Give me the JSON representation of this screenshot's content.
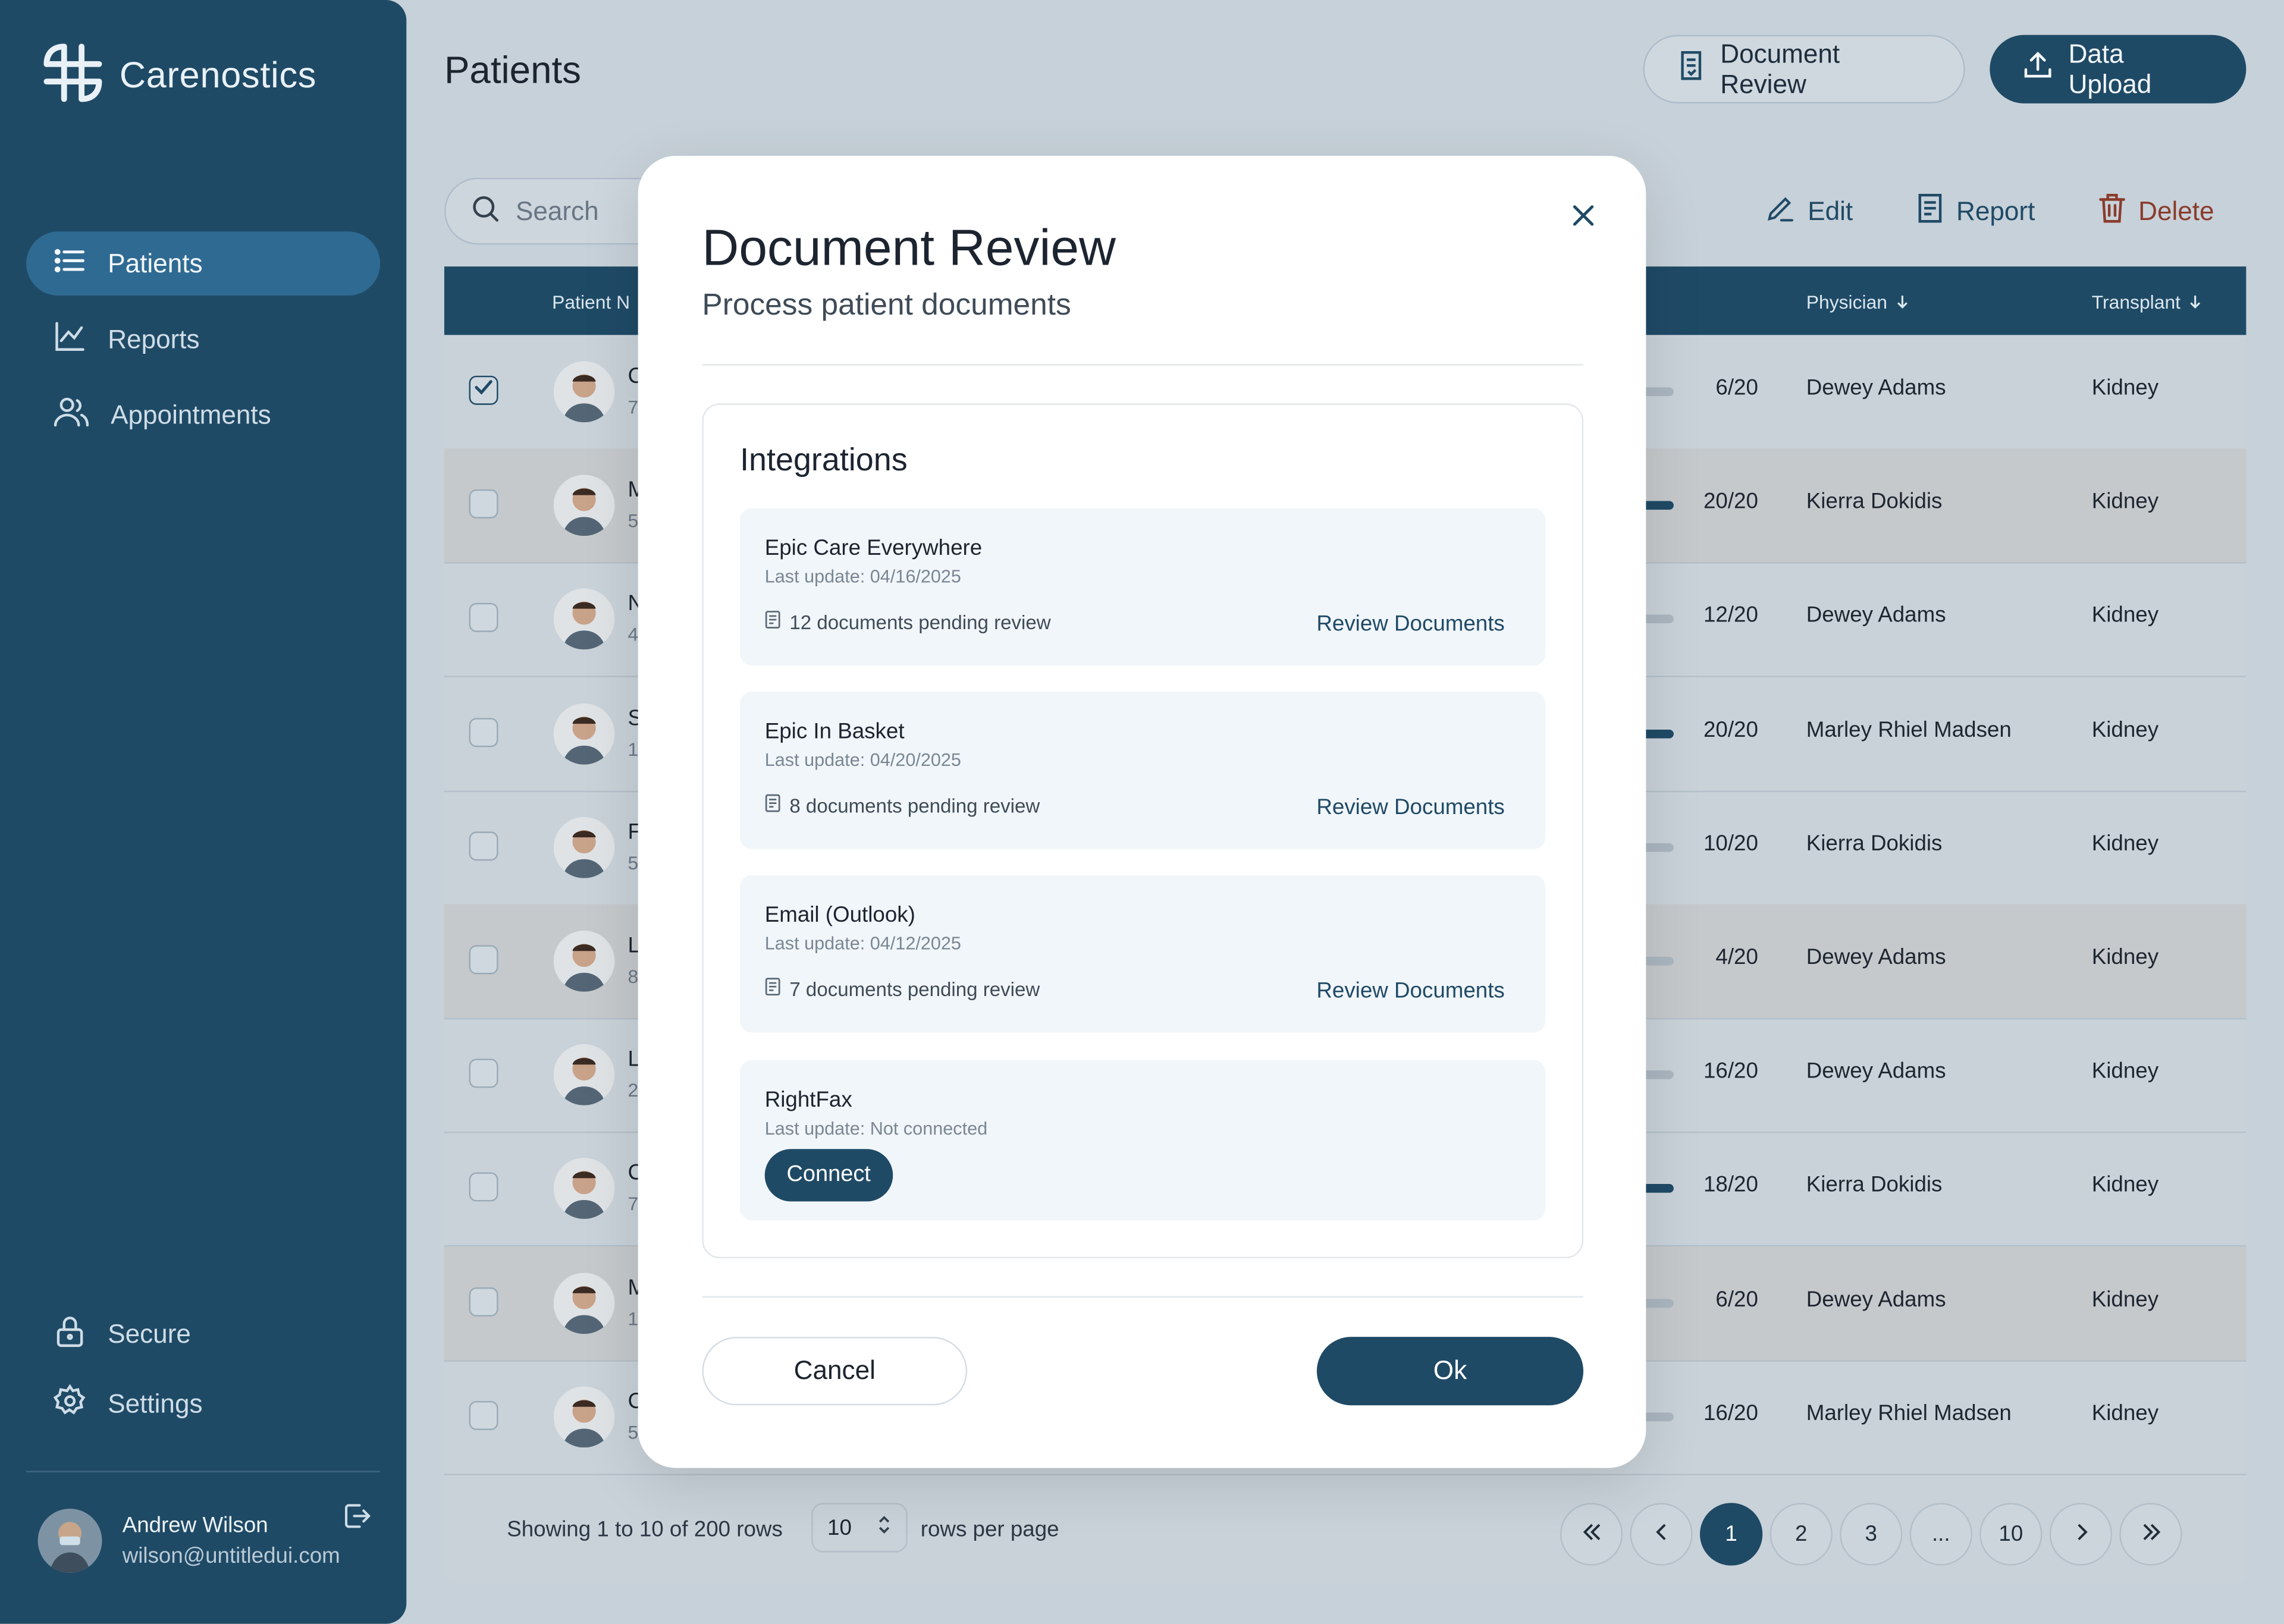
{
  "brand": {
    "name": "Carenostics"
  },
  "sidebar": {
    "items": [
      {
        "label": "Patients",
        "icon": "list-icon"
      },
      {
        "label": "Reports",
        "icon": "chart-line-icon"
      },
      {
        "label": "Appointments",
        "icon": "users-icon"
      }
    ],
    "bottom_items": [
      {
        "label": "Secure",
        "icon": "lock-icon"
      },
      {
        "label": "Settings",
        "icon": "gear-icon"
      }
    ],
    "user": {
      "name": "Andrew Wilson",
      "email": "wilson@untitledui.com"
    }
  },
  "header": {
    "title": "Patients",
    "document_review_label": "Document Review",
    "data_upload_label": "Data Upload"
  },
  "toolbar": {
    "search_placeholder": "Search",
    "edit_label": "Edit",
    "report_label": "Report",
    "delete_label": "Delete"
  },
  "table": {
    "headers": {
      "patient": "Patient N",
      "physician": "Physician",
      "transplant": "Transplant"
    },
    "rows": [
      {
        "name": "C",
        "sub": "7",
        "progress": "6/20",
        "physician": "Dewey Adams",
        "transplant": "Kidney",
        "checked": true,
        "full": false,
        "shade": false
      },
      {
        "name": "M",
        "sub": "5",
        "progress": "20/20",
        "physician": "Kierra Dokidis",
        "transplant": "Kidney",
        "checked": false,
        "full": true,
        "shade": true
      },
      {
        "name": "N",
        "sub": "4",
        "progress": "12/20",
        "physician": "Dewey Adams",
        "transplant": "Kidney",
        "checked": false,
        "full": false,
        "shade": false
      },
      {
        "name": "S",
        "sub": "1",
        "progress": "20/20",
        "physician": "Marley Rhiel Madsen",
        "transplant": "Kidney",
        "checked": false,
        "full": true,
        "shade": false
      },
      {
        "name": "F",
        "sub": "5",
        "progress": "10/20",
        "physician": "Kierra Dokidis",
        "transplant": "Kidney",
        "checked": false,
        "full": false,
        "shade": false
      },
      {
        "name": "L",
        "sub": "8",
        "progress": "4/20",
        "physician": "Dewey Adams",
        "transplant": "Kidney",
        "checked": false,
        "full": false,
        "shade": true
      },
      {
        "name": "L",
        "sub": "2",
        "progress": "16/20",
        "physician": "Dewey Adams",
        "transplant": "Kidney",
        "checked": false,
        "full": false,
        "shade": false
      },
      {
        "name": "C",
        "sub": "7",
        "progress": "18/20",
        "physician": "Kierra Dokidis",
        "transplant": "Kidney",
        "checked": false,
        "full": true,
        "shade": false
      },
      {
        "name": "M",
        "sub": "1",
        "progress": "6/20",
        "physician": "Dewey Adams",
        "transplant": "Kidney",
        "checked": false,
        "full": false,
        "shade": true
      },
      {
        "name": "C",
        "sub": "5",
        "progress": "16/20",
        "physician": "Marley Rhiel Madsen",
        "transplant": "Kidney",
        "checked": false,
        "full": false,
        "shade": false
      }
    ],
    "footer": {
      "showing": "Showing 1 to 10 of 200 rows",
      "per_page": "10",
      "rows_per_page": "rows per page",
      "pages": [
        "1",
        "2",
        "3",
        "...",
        "10"
      ]
    }
  },
  "modal": {
    "title": "Document Review",
    "subtitle": "Process patient documents",
    "integrations_title": "Integrations",
    "cards": [
      {
        "name": "Epic Care Everywhere",
        "update": "Last update: 04/16/2025",
        "pending": "12 documents pending review",
        "action": "Review Documents"
      },
      {
        "name": "Epic In Basket",
        "update": "Last update: 04/20/2025",
        "pending": "8 documents pending review",
        "action": "Review Documents"
      },
      {
        "name": "Email (Outlook)",
        "update": "Last update: 04/12/2025",
        "pending": "7 documents pending review",
        "action": "Review Documents"
      },
      {
        "name": "RightFax",
        "update": "Last update: Not connected",
        "connect": "Connect"
      }
    ],
    "cancel_label": "Cancel",
    "ok_label": "Ok"
  },
  "colors": {
    "primary": "#1f4a66",
    "danger": "#8a3b2b",
    "overlay_bg": "#c7d1d9"
  }
}
